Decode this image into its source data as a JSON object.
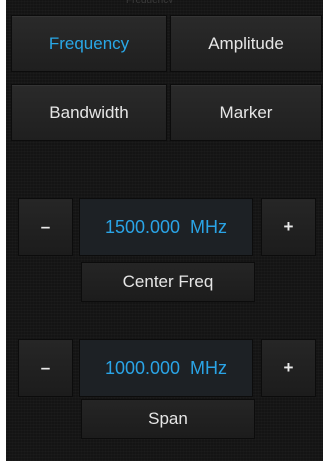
{
  "header_strip": "Frequency",
  "tabs": [
    {
      "label": "Frequency",
      "active": true
    },
    {
      "label": "Amplitude",
      "active": false
    },
    {
      "label": "Bandwidth",
      "active": false
    },
    {
      "label": "Marker",
      "active": false
    }
  ],
  "center_freq": {
    "decrement_label": "–",
    "value": "1500.000  MHz",
    "increment_label": "+",
    "label": "Center Freq"
  },
  "span": {
    "decrement_label": "–",
    "value": "1000.000  MHz",
    "increment_label": "+",
    "label": "Span"
  },
  "colors": {
    "accent": "#29a7e6",
    "background": "#141414",
    "button": "#242424",
    "text": "#e6e6e6"
  }
}
